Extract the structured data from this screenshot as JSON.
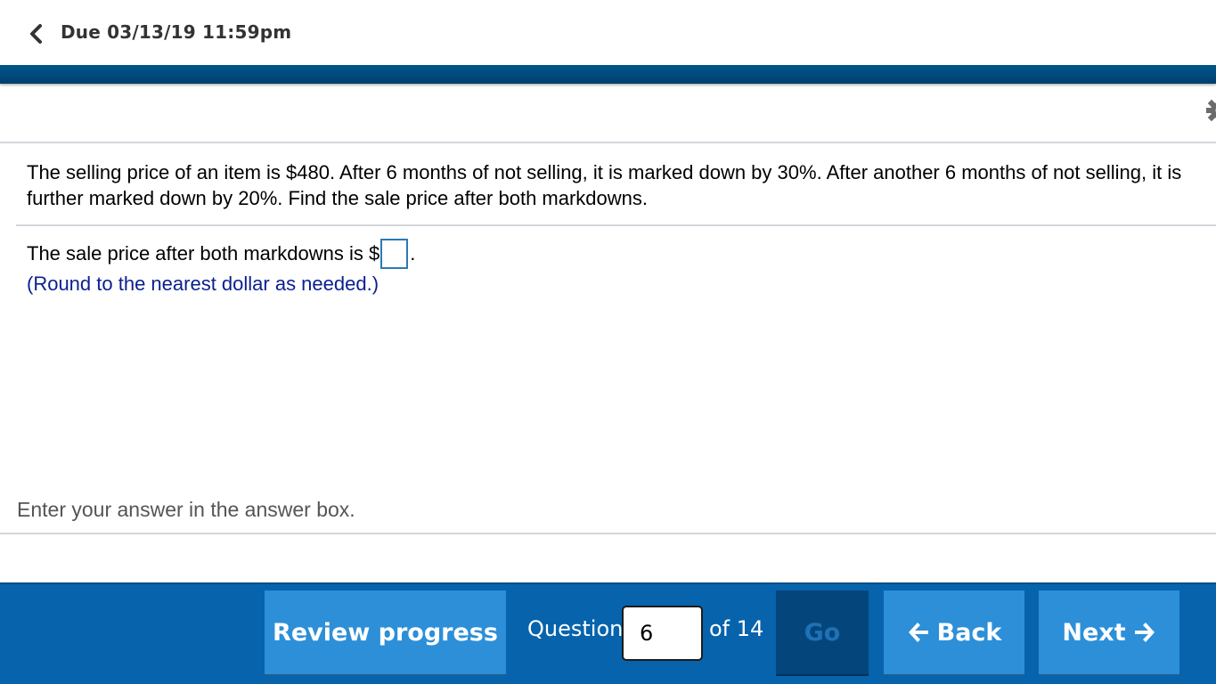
{
  "header": {
    "back_icon": "chevron-left-icon",
    "due_label": "Due 03/13/19 11:59pm",
    "band_color": "#00558c"
  },
  "toolbar": {
    "settings_icon": "gear-icon"
  },
  "question": {
    "text": "The selling price of an item is $480. After 6 months of not selling, it is marked down by 30%. After another 6 months of not selling, it is further marked down by 20%. Find the sale price after both markdowns.",
    "answer_prefix": "The sale price after both markdowns is $",
    "answer_value": "",
    "answer_suffix": ".",
    "hint": "(Round to the nearest dollar as needed.)"
  },
  "instruction": "Enter your answer in the answer box.",
  "navigation": {
    "review_label": "Review progress",
    "question_label": "Question",
    "question_number": "6",
    "of_total_label": "of 14",
    "go_label": "Go",
    "back_label": "Back",
    "next_label": "Next",
    "bar_color": "#0763ac",
    "button_color": "#2c8fd8"
  }
}
